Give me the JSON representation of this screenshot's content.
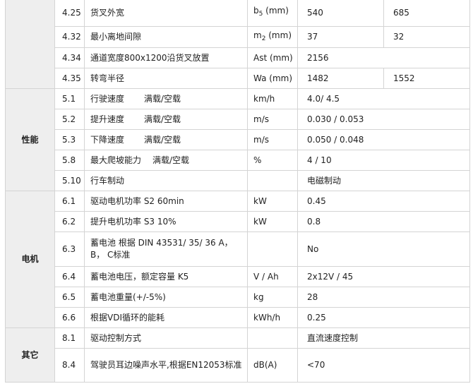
{
  "sections": {
    "performance": "性能",
    "motor": "电机",
    "other": "其它"
  },
  "rows": [
    {
      "no": "4.25",
      "desc": "货叉外宽",
      "unit": "b",
      "unit_sub": "5",
      "unit_tail": " (mm)",
      "v1": "540",
      "v2": "685"
    },
    {
      "no": "4.32",
      "desc": "最小离地间隙",
      "unit": "m",
      "unit_sub": "2",
      "unit_tail": " (mm)",
      "v1": "37",
      "v2": "32"
    },
    {
      "no": "4.34",
      "desc": "通道宽度800x1200沿货叉放置",
      "unit": "Ast (mm)",
      "v1": "2156"
    },
    {
      "no": "4.35",
      "desc": "转弯半径",
      "unit": "Wa (mm)",
      "v1": "1482",
      "v2": "1552"
    },
    {
      "no": "5.1",
      "desc": "行驶速度",
      "desc_sub": "满载/空载",
      "unit": "km/h",
      "v1": "4.0/ 4.5"
    },
    {
      "no": "5.2",
      "desc": "提升速度",
      "desc_sub": "满载/空载",
      "unit": "m/s",
      "v1": "0.030 / 0.053"
    },
    {
      "no": "5.3",
      "desc": "下降速度",
      "desc_sub": "满载/空载",
      "unit": "m/s",
      "v1": "0.050 / 0.048"
    },
    {
      "no": "5.8",
      "desc": "最大爬坡能力",
      "desc_sub": "满载/空载",
      "unit": "%",
      "v1": "4 / 10"
    },
    {
      "no": "5.10",
      "desc": "行车制动",
      "unit": "",
      "v1": "电磁制动"
    },
    {
      "no": "6.1",
      "desc": "驱动电机功率 S2 60min",
      "unit": "kW",
      "v1": "0.45"
    },
    {
      "no": "6.2",
      "desc": "提升电机功率 S3 10%",
      "unit": "kW",
      "v1": "0.8"
    },
    {
      "no": "6.3",
      "desc": "蓄电池 根据 DIN 43531/ 35/ 36 A， B， C标准",
      "unit": "",
      "v1": "No"
    },
    {
      "no": "6.4",
      "desc": "蓄电池电压，额定容量 K5",
      "unit": "V / Ah",
      "v1": "2x12V / 45"
    },
    {
      "no": "6.5",
      "desc": "蓄电池重量(+/-5%)",
      "unit": "kg",
      "v1": "28"
    },
    {
      "no": "6.6",
      "desc": "根据VDI循环的能耗",
      "unit": "kWh/h",
      "v1": "0.25"
    },
    {
      "no": "8.1",
      "desc": "驱动控制方式",
      "unit": "",
      "v1": "直流速度控制"
    },
    {
      "no": "8.4",
      "desc": "驾驶员耳边噪声水平,根据EN12053标准",
      "unit": "dB(A)",
      "v1": "<70"
    }
  ]
}
